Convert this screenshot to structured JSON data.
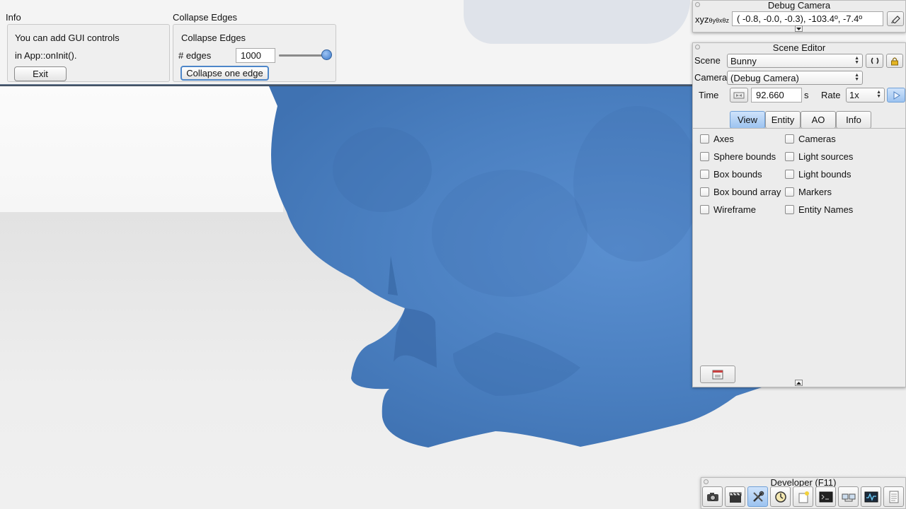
{
  "info_pane": {
    "title": "Info",
    "line1": "You can add GUI controls",
    "line2": "in App::onInit().",
    "exit_label": "Exit"
  },
  "collapse_pane": {
    "title": "Collapse Edges",
    "heading": "Collapse Edges",
    "edges_label": "# edges",
    "edges_value": "1000",
    "edges_slider_fraction": 0.97,
    "collapse_button_label": "Collapse one edge"
  },
  "debug_camera": {
    "title": "Debug Camera",
    "xyz_label": "xyz",
    "xyz_sub_label": "θyθxθz",
    "position_value": "( -0.8,  -0.0,  -0.3), -103.4º,  -7.4º"
  },
  "scene_editor": {
    "title": "Scene Editor",
    "scene_label": "Scene",
    "scene_value": "Bunny",
    "camera_label": "Camera",
    "camera_value": "(Debug Camera)",
    "time_label": "Time",
    "time_value": "92.660",
    "time_unit": "s",
    "rate_label": "Rate",
    "rate_value": "1x",
    "tabs": [
      "View",
      "Entity",
      "AO",
      "Info"
    ],
    "active_tab": "View",
    "checkboxes_left": [
      "Axes",
      "Sphere bounds",
      "Box bounds",
      "Box bound array",
      "Wireframe"
    ],
    "checkboxes_right": [
      "Cameras",
      "Light sources",
      "Light bounds",
      "Markers",
      "Entity Names"
    ]
  },
  "developer": {
    "title": "Developer (F11)",
    "icons": [
      "camera-icon",
      "film-clapper-icon",
      "tools-icon",
      "clock-icon",
      "new-document-icon",
      "terminal-icon",
      "network-icon",
      "profiler-icon",
      "log-icon"
    ],
    "active_icon": "tools-icon"
  },
  "colors": {
    "bunny_blue": "#4a7fc0",
    "accent_blue": "#9cc3f0"
  }
}
